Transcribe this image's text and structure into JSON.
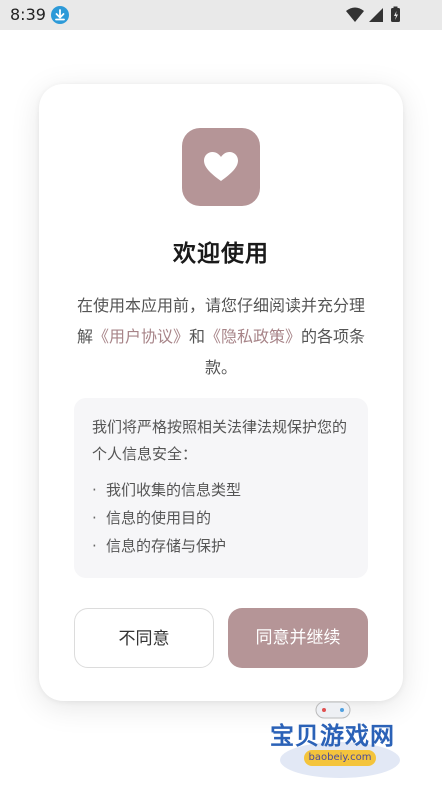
{
  "status_bar": {
    "time": "8:39",
    "icons": [
      "download-icon",
      "wifi-icon",
      "signal-icon",
      "battery-icon"
    ]
  },
  "dialog": {
    "icon": "heart-icon",
    "accent_color": "#b59597",
    "title": "欢迎使用",
    "intro": {
      "before": "在使用本应用前，请您仔细阅读并充分理解",
      "link_agreement": "《用户协议》",
      "conjunction": "和",
      "link_privacy": "《隐私政策》",
      "after": "的各项条款。"
    },
    "info_box": {
      "text": "我们将严格按照相关法律法规保护您的个人信息安全：",
      "items": [
        "我们收集的信息类型",
        "信息的使用目的",
        "信息的存储与保护"
      ]
    },
    "buttons": {
      "decline": "不同意",
      "accept": "同意并继续"
    }
  },
  "watermark": {
    "text": "宝贝游戏网",
    "url": "baobeiy.com"
  }
}
